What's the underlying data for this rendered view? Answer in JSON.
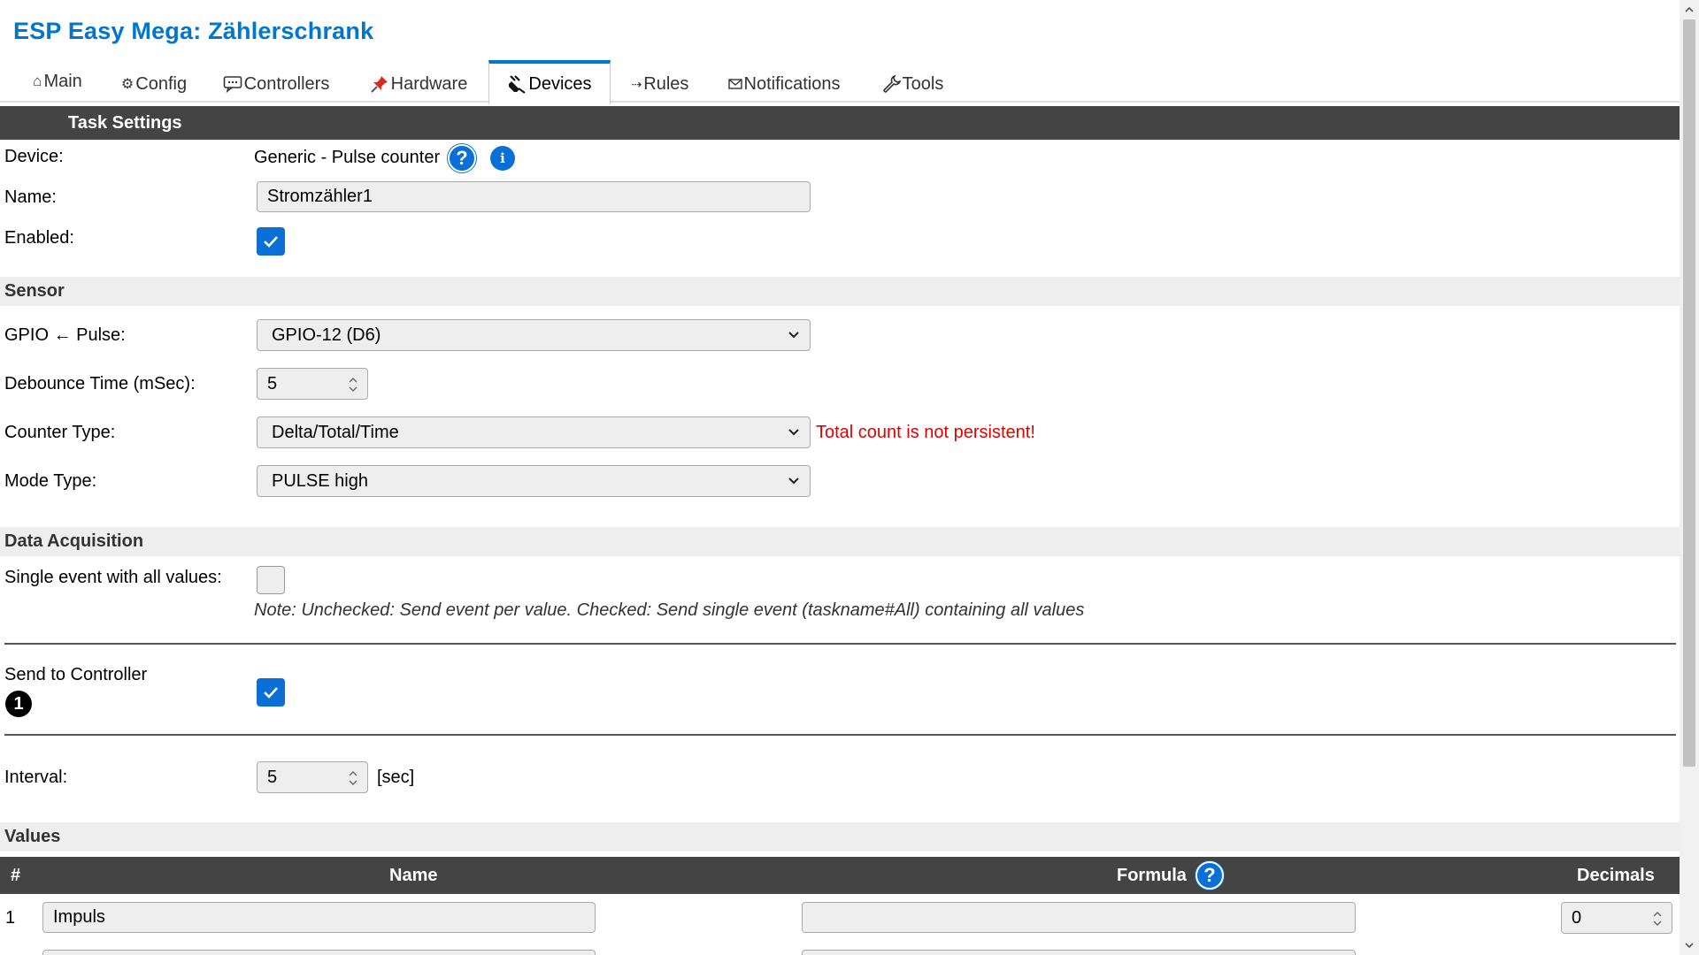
{
  "app": {
    "title": "ESP Easy Mega: Zählerschrank"
  },
  "tabs": [
    {
      "label": "Main",
      "icon": "home-icon"
    },
    {
      "label": "Config",
      "icon": "gear-icon"
    },
    {
      "label": "Controllers",
      "icon": "speech-bubble-icon"
    },
    {
      "label": "Hardware",
      "icon": "pin-icon"
    },
    {
      "label": "Devices",
      "icon": "plug-icon",
      "active": true
    },
    {
      "label": "Rules",
      "icon": "arrow-icon"
    },
    {
      "label": "Notifications",
      "icon": "envelope-icon"
    },
    {
      "label": "Tools",
      "icon": "wrench-icon"
    }
  ],
  "task": {
    "header": "Task Settings",
    "device_label": "Device:",
    "device_value": "Generic - Pulse counter",
    "name_label": "Name:",
    "name_value": "Stromzähler1",
    "enabled_label": "Enabled:",
    "enabled": true
  },
  "sensor": {
    "header": "Sensor",
    "gpio_label": "GPIO ← Pulse:",
    "gpio_value": "GPIO-12 (D6)",
    "debounce_label": "Debounce Time (mSec):",
    "debounce_value": "5",
    "counter_type_label": "Counter Type:",
    "counter_type_value": "Delta/Total/Time",
    "counter_warning": "Total count is not persistent!",
    "mode_type_label": "Mode Type:",
    "mode_type_value": "PULSE high"
  },
  "acquisition": {
    "header": "Data Acquisition",
    "single_event_label": "Single event with all values:",
    "single_event": false,
    "note": "Note: Unchecked: Send event per value. Checked: Send single event (taskname#All) containing all values",
    "send_controller_label": "Send to Controller",
    "controller_number": "1",
    "send_controller": true,
    "interval_label": "Interval:",
    "interval_value": "5",
    "interval_unit": "[sec]"
  },
  "values": {
    "header": "Values",
    "col_num": "#",
    "col_name": "Name",
    "col_formula": "Formula",
    "col_decimals": "Decimals",
    "rows": [
      {
        "num": "1",
        "name": "Impuls",
        "formula": "",
        "decimals": "0"
      }
    ]
  },
  "colors": {
    "accent": "#0077cc",
    "dark_header": "#444444",
    "warning": "#e00000"
  }
}
